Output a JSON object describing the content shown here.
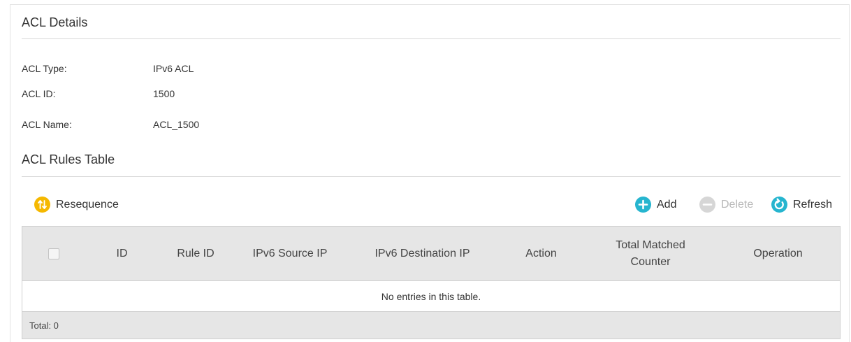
{
  "details": {
    "title": "ACL Details",
    "fields": [
      {
        "label": "ACL Type:",
        "value": "IPv6 ACL"
      },
      {
        "label": "ACL ID:",
        "value": "1500"
      },
      {
        "label": "ACL Name:",
        "value": "ACL_1500"
      }
    ]
  },
  "rules": {
    "title": "ACL Rules Table",
    "toolbar": {
      "resequence": "Resequence",
      "add": "Add",
      "delete": "Delete",
      "refresh": "Refresh"
    },
    "columns": [
      "ID",
      "Rule ID",
      "IPv6 Source IP",
      "IPv6 Destination IP",
      "Action",
      "Total Matched",
      "Counter",
      "Operation"
    ],
    "empty_message": "No entries in this table.",
    "total": "Total: 0"
  },
  "colors": {
    "resequence_icon": "#f5b800",
    "add_icon": "#26b5cf",
    "delete_icon": "#d6d6d6",
    "refresh_icon": "#26b5cf"
  },
  "icons": {
    "resequence": "resequence-icon",
    "add": "plus-circle-icon",
    "delete": "minus-circle-icon",
    "refresh": "refresh-icon"
  }
}
